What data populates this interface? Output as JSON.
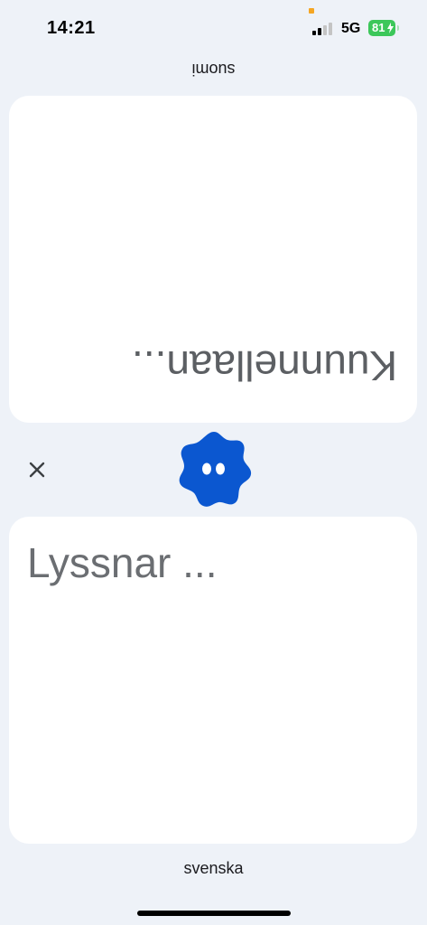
{
  "status_bar": {
    "time": "14:21",
    "network": "5G",
    "battery_percent": "81",
    "battery_charging": true,
    "signal_bars": 2,
    "signal_bars_total": 4,
    "privacy_indicator_color": "#f5a623",
    "battery_color": "#3cc75a"
  },
  "top_panel": {
    "language": "suomi",
    "status_text": "Kuunnellaan...",
    "orientation": "upside-down"
  },
  "controls": {
    "close_icon": "close-icon",
    "mic_icon": "listening-blob-icon",
    "mic_color": "#0b57d0"
  },
  "bottom_panel": {
    "status_text": "Lyssnar ...",
    "language": "svenska"
  }
}
